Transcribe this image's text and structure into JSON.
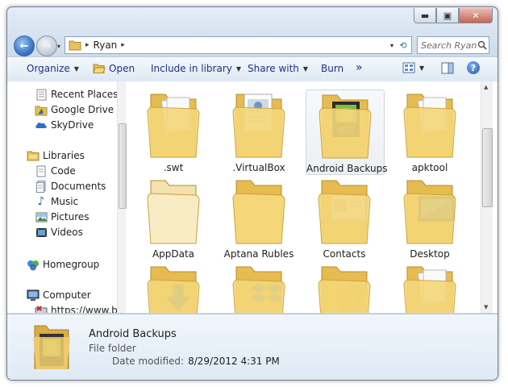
{
  "window": {
    "minimize": "▬",
    "maximize": "▣",
    "close": "✕"
  },
  "nav": {
    "back_icon": "←",
    "forward_icon": "→",
    "dropdown": "▾"
  },
  "address": {
    "crumbs": [
      "Ryan"
    ],
    "separator": "▸",
    "refresh_icon": "⟲"
  },
  "search": {
    "placeholder": "Search Ryan",
    "icon": "magnifier-icon"
  },
  "toolbar": {
    "organize": "Organize",
    "open": "Open",
    "include_in_library": "Include in library",
    "share_with": "Share with",
    "burn": "Burn",
    "more": "»"
  },
  "sidebar": {
    "favorites": [
      {
        "label": "Recent Places",
        "icon": "recent-places-icon"
      },
      {
        "label": "Google Drive",
        "icon": "google-drive-icon"
      },
      {
        "label": "SkyDrive",
        "icon": "skydrive-icon"
      }
    ],
    "libraries": {
      "label": "Libraries",
      "items": [
        {
          "label": "Code",
          "icon": "document-icon"
        },
        {
          "label": "Documents",
          "icon": "documents-icon"
        },
        {
          "label": "Music",
          "icon": "music-icon"
        },
        {
          "label": "Pictures",
          "icon": "pictures-icon"
        },
        {
          "label": "Videos",
          "icon": "videos-icon"
        }
      ]
    },
    "homegroup": "Homegroup",
    "computer": {
      "label": "Computer",
      "items": [
        {
          "label": "https://www.bo",
          "icon": "network-drive-icon"
        }
      ]
    }
  },
  "files": [
    {
      "name": ".swt",
      "overlay": "papers"
    },
    {
      "name": ".VirtualBox",
      "overlay": "documents"
    },
    {
      "name": "Android Backups",
      "overlay": "android",
      "selected": true
    },
    {
      "name": "apktool",
      "overlay": "papers"
    },
    {
      "name": "AppData",
      "overlay": "faded"
    },
    {
      "name": "Aptana Rubles",
      "overlay": "none"
    },
    {
      "name": "Contacts",
      "overlay": "contact-card"
    },
    {
      "name": "Desktop",
      "overlay": "monitor"
    },
    {
      "name": "",
      "overlay": "download-arrow"
    },
    {
      "name": "",
      "overlay": "dropbox"
    },
    {
      "name": "",
      "overlay": "star"
    },
    {
      "name": "",
      "overlay": "papers"
    }
  ],
  "details": {
    "name": "Android Backups",
    "type": "File folder",
    "date_label": "Date modified:",
    "date_value": "8/29/2012 4:31 PM"
  }
}
